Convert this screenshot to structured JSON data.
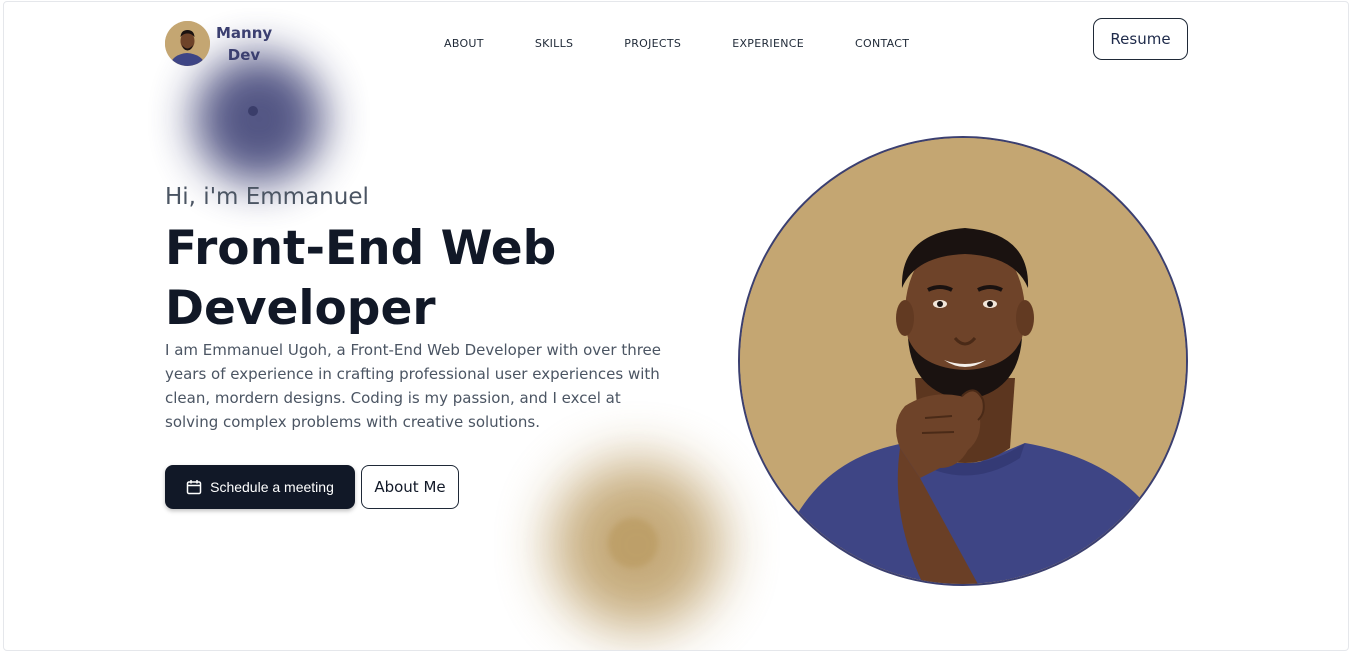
{
  "header": {
    "logo_line1": "Manny",
    "logo_line2": "Dev",
    "nav": [
      {
        "label": "ABOUT"
      },
      {
        "label": "SKILLS"
      },
      {
        "label": "PROJECTS"
      },
      {
        "label": "EXPERIENCE"
      },
      {
        "label": "CONTACT"
      }
    ],
    "resume_label": "Resume"
  },
  "hero": {
    "greeting": "Hi, i'm Emmanuel",
    "headline": "Front-End Web Developer",
    "bio": "I am Emmanuel Ugoh, a Front-End Web Developer with over three years of experience in crafting professional user experiences with clean, mordern designs. Coding is my passion, and I excel at solving complex problems with creative solutions.",
    "primary_button": "Schedule a meeting",
    "secondary_button": "About Me"
  },
  "colors": {
    "navy": "#3b3f70",
    "gold": "#c4a672",
    "dark": "#111827",
    "shirt": "#3e4585",
    "skin": "#6e4329"
  },
  "icons": {
    "primary_button_icon": "calendar-icon"
  }
}
